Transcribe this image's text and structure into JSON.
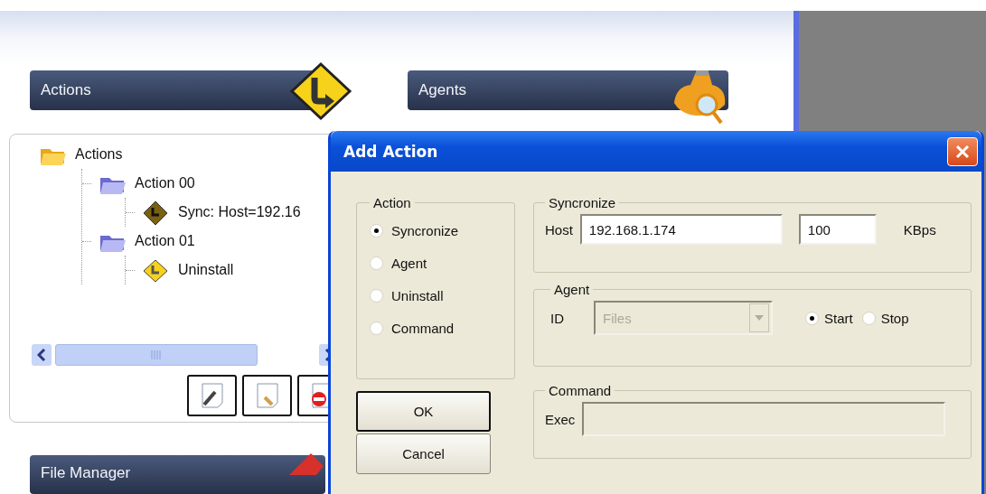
{
  "headers": [
    {
      "title": "Actions",
      "kind": "actions"
    },
    {
      "title": "Agents",
      "kind": "agents"
    }
  ],
  "tree": [
    {
      "label": "Actions",
      "kind": "folder",
      "children": [
        {
          "label": "Action 00",
          "kind": "action",
          "children": [
            {
              "label": "Sync: Host=192.16",
              "kind": "sync"
            }
          ]
        },
        {
          "label": "Action 01",
          "kind": "action",
          "children": [
            {
              "label": "Uninstall",
              "kind": "uninstall"
            }
          ]
        }
      ]
    }
  ],
  "tree_buttons": [
    {
      "kind": "edit"
    },
    {
      "kind": "add"
    },
    {
      "kind": "delete"
    }
  ],
  "bottom_header": {
    "title": "File Manager",
    "kind": "files"
  },
  "dialog": {
    "title": "Add Action",
    "action_group": {
      "label": "Action",
      "options": [
        {
          "label": "Syncronize",
          "selected": true
        },
        {
          "label": "Agent",
          "selected": false
        },
        {
          "label": "Uninstall",
          "selected": false
        },
        {
          "label": "Command",
          "selected": false
        }
      ]
    },
    "sync_group": {
      "label": "Syncronize",
      "host_label": "Host",
      "host": "192.168.1.174",
      "rate": "100",
      "unit": "KBps"
    },
    "agent_group": {
      "label": "Agent",
      "id_label": "ID",
      "id_value": "Files",
      "id_disabled": true,
      "modes": [
        {
          "label": "Start",
          "selected": true
        },
        {
          "label": "Stop",
          "selected": false
        }
      ]
    },
    "command_group": {
      "label": "Command",
      "exec_label": "Exec",
      "exec_disabled": true
    },
    "buttons": [
      {
        "label": "OK",
        "default": true
      },
      {
        "label": "Cancel",
        "default": false
      }
    ]
  }
}
